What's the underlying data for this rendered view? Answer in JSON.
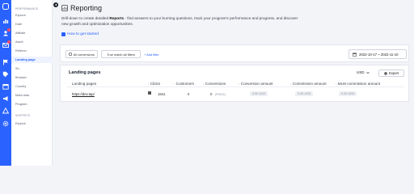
{
  "icon_rail": {
    "icons": [
      "logo-icon",
      "chart-icon",
      "users-icon",
      "envelope-icon",
      "flag-icon",
      "tag-icon",
      "calendar-icon",
      "megaphone-icon",
      "triangle-icon",
      "gear-icon"
    ],
    "accent": "#2962ff",
    "badge_color": "#ff4d6d"
  },
  "sidebar": {
    "section1": "PERFORMANCE",
    "items": [
      "Explore",
      "Date",
      "Affiliate",
      "Asset",
      "Referrer",
      "Landing page",
      "Sh.",
      "Browser",
      "Country",
      "Meta data",
      "Program"
    ],
    "active": "Landing page",
    "section2": "SNIPPETS",
    "items2": [
      "Explore"
    ]
  },
  "header": {
    "title": "Reporting",
    "description_pre": "Drill-down to create detailed ",
    "description_bold": "Reports",
    "description_post": " - find answers to your burning questions, track your program's performance and progress, and discover new growth and optimization opportunities.",
    "howto": "How to get started"
  },
  "toolbar": {
    "filter1": "All conversions",
    "filter2": "True match all filters",
    "add_filter": "+ Add filter",
    "date_range": "2022-10-17 ~ 2022-11-10"
  },
  "panel": {
    "title": "Landing pages",
    "currency": "USD",
    "export_label": "Export",
    "columns": [
      "Landing pages",
      "Clicks",
      "Customers",
      "Conversions",
      "Conversion amount",
      "Commission amount",
      "MLM commission amount"
    ],
    "row": {
      "page": "https://dev.tap/",
      "clicks": "1841",
      "customers": "0",
      "conversions": "0",
      "conversions_sub": "(PRICE)",
      "conversion_amount": "0.00 USD",
      "commission_amount": "0.00 USD",
      "mlm_amount": "0.00 USD"
    }
  }
}
